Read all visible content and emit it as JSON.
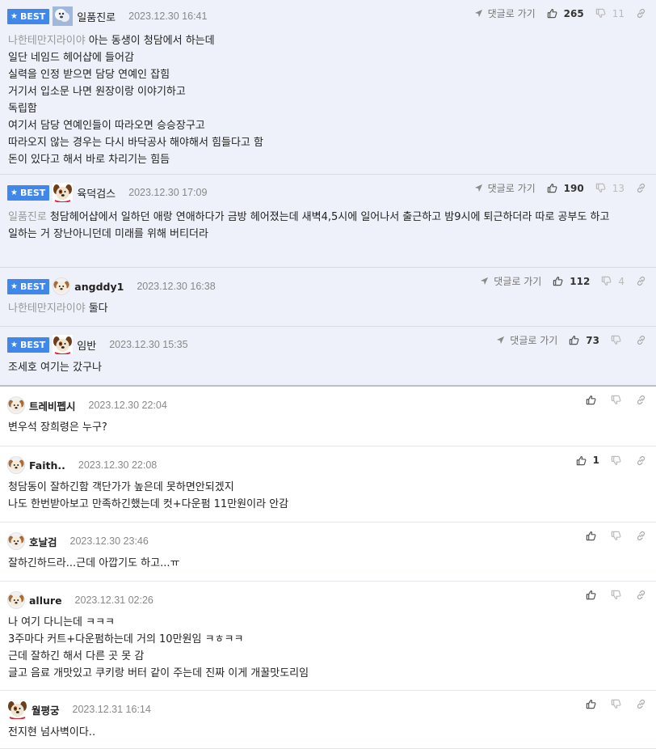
{
  "ui": {
    "best_label": "BEST",
    "reply_label": "댓글로 가기",
    "accent_color": "#3f87e8"
  },
  "comments": [
    {
      "best": true,
      "avatar": "polarbear-avatar",
      "author": "일품진로",
      "date": "2023.12.30 16:41",
      "up": "265",
      "down": "11",
      "mention": "나한테만지라이야",
      "lines": [
        "아는 동생이 청담에서 하는데",
        "일단 네임드 헤어샵에 들어감",
        "실력을 인정 받으면 담당 연예인 잡힘",
        "거기서 입소문 나면 원장이랑 이야기하고",
        "독립함",
        "여기서 담당 연예인들이 따라오면 승승장구고",
        "따라오지 않는 경우는 다시 바닥공사 해야해서 힘들다고 함",
        "돈이 있다고 해서 바로 차리기는 힘듬"
      ]
    },
    {
      "best": true,
      "avatar": "dog-avatar",
      "author": "육덕검스",
      "date": "2023.12.30 17:09",
      "up": "190",
      "down": "13",
      "mention": "일품진로",
      "lines": [
        "청담헤어샵에서 일하던 애랑 연애하다가 금방 헤어졌는데 새벽4,5시에 일어나서 출근하고 밤9시에 퇴근하더라 따로 공부도 하고",
        "일하는 거 장난아니던데 미래를 위해 버티더라"
      ]
    },
    {
      "best": true,
      "avatar": "default-avatar",
      "author": "angddy1",
      "date": "2023.12.30 16:38",
      "up": "112",
      "down": "4",
      "mention": "나한테만지라이야",
      "lines": [
        "둘다"
      ]
    },
    {
      "best": true,
      "avatar": "dog-avatar",
      "author": "임반",
      "date": "2023.12.30 15:35",
      "up": "73",
      "down": "",
      "mention": "",
      "lines": [
        "조세호 여기는 갔구나"
      ]
    },
    {
      "best": false,
      "avatar": "default-avatar",
      "author": "트레비펩시",
      "date": "2023.12.30 22:04",
      "up": "",
      "down": "",
      "mention": "",
      "lines": [
        "변우석 장희령은 누구?"
      ]
    },
    {
      "best": false,
      "avatar": "default-avatar",
      "author": "Faith..",
      "date": "2023.12.30 22:08",
      "up": "1",
      "down": "",
      "mention": "",
      "lines": [
        "청담동이 잘하긴함 객단가가 높은데 못하면안되겠지",
        "나도 한번받아보고 만족하긴했는데 컷+다운펌 11만원이라 안감"
      ]
    },
    {
      "best": false,
      "avatar": "default-avatar",
      "author": "호날검",
      "date": "2023.12.30 23:46",
      "up": "",
      "down": "",
      "mention": "",
      "lines": [
        "잘하긴하드라...근데 아깝기도 하고...ㅠ"
      ]
    },
    {
      "best": false,
      "avatar": "default-avatar",
      "author": "allure",
      "date": "2023.12.31 02:26",
      "up": "",
      "down": "",
      "mention": "",
      "lines": [
        "나 여기 다니는데 ㅋㅋㅋ",
        "3주마다 커트+다운펌하는데 거의 10만원임 ㅋㅎㅋㅋ",
        "근데 잘하긴 해서 다른 곳 못 감",
        "글고 음료 개맛있고 쿠키랑 버터 같이 주는데 진짜 이게 개꿀맛도리임"
      ]
    },
    {
      "best": false,
      "avatar": "dog-avatar",
      "author": "월평궁",
      "date": "2023.12.31 16:14",
      "up": "",
      "down": "",
      "mention": "",
      "lines": [
        "전지현 넘사벽이다.."
      ]
    }
  ]
}
